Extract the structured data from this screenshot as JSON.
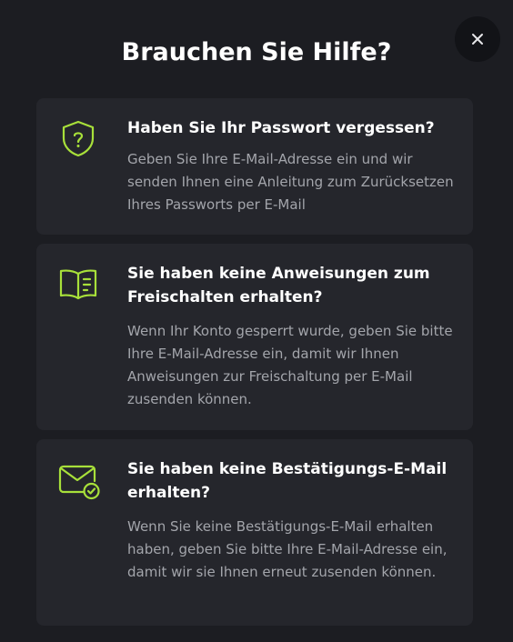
{
  "modal": {
    "title": "Brauchen Sie Hilfe?",
    "close_icon": "close-icon",
    "accent_color": "#a8e03a"
  },
  "cards": [
    {
      "icon": "shield-question-icon",
      "title": "Haben Sie Ihr Passwort vergessen?",
      "description": "Geben Sie Ihre E-Mail-Adresse ein und wir senden Ihnen eine Anleitung zum Zurücksetzen Ihres Passworts per E-Mail"
    },
    {
      "icon": "book-icon",
      "title": "Sie haben keine Anweisungen zum Freischalten erhalten?",
      "description": "Wenn Ihr Konto gesperrt wurde, geben Sie bitte Ihre E-Mail-Adresse ein, damit wir Ihnen Anweisungen zur Freischaltung per E-Mail zusenden können."
    },
    {
      "icon": "mail-check-icon",
      "title": "Sie haben keine Bestätigungs-E-Mail erhalten?",
      "description": "Wenn Sie keine Bestätigungs-E-Mail erhalten haben, geben Sie bitte Ihre E-Mail-Adresse ein, damit wir sie Ihnen erneut zusenden können."
    }
  ]
}
